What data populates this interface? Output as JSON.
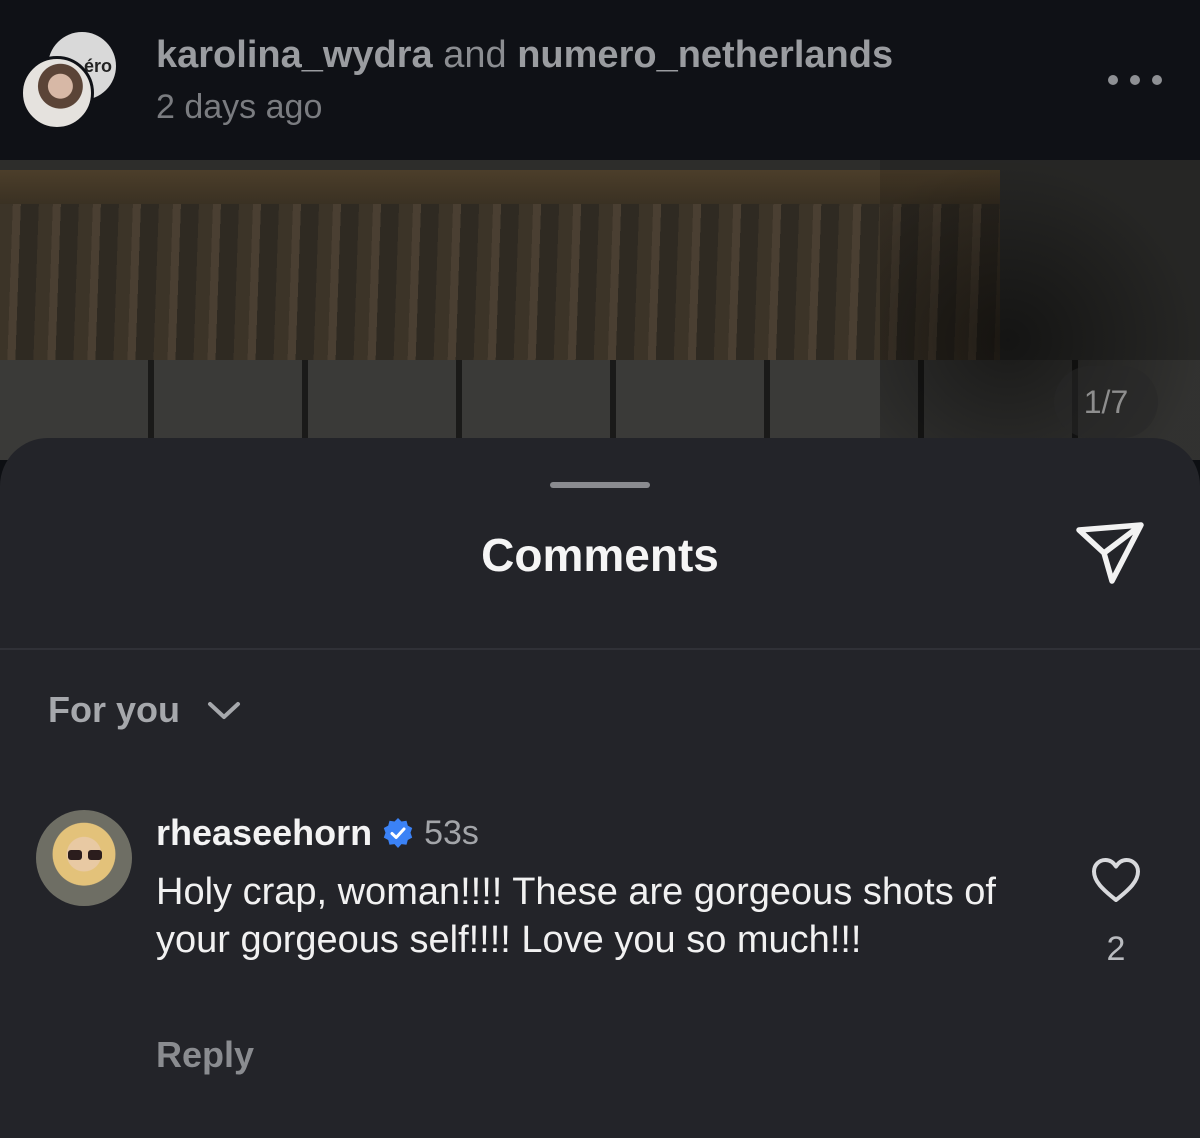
{
  "post": {
    "user1": "karolina_wydra",
    "conjunction": "and",
    "user2": "numero_netherlands",
    "time": "2 days ago",
    "collab_logo_text": "éro",
    "page_counter": "1/7"
  },
  "comments_sheet": {
    "title": "Comments",
    "sort_label": "For you"
  },
  "comment": {
    "username": "rheaseehorn",
    "verified": true,
    "time": "53s",
    "text": "Holy crap, woman!!!! These are gorgeous shots of your gorgeous self!!!! Love you so much!!!",
    "likes": "2",
    "reply_label": "Reply"
  },
  "colors": {
    "sheet_bg": "#232429",
    "verified_blue": "#3b82f6"
  }
}
